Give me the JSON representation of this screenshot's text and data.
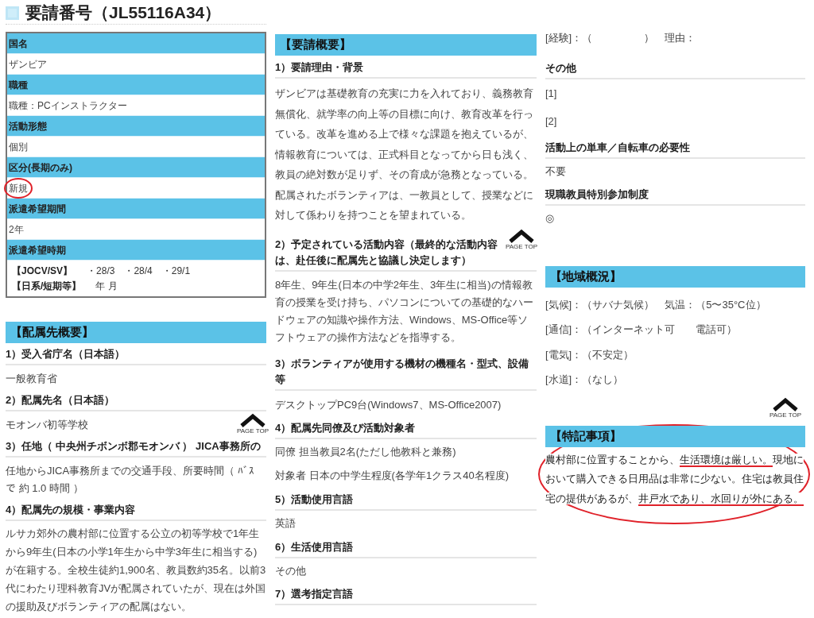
{
  "title": {
    "text": "要請番号（JL55116A34）"
  },
  "summary_table": [
    {
      "label": "国名",
      "kind": "text",
      "value": "ザンビア",
      "circled": false
    },
    {
      "label": "職種",
      "kind": "text",
      "value": "職種：PCインストラクター",
      "circled": false
    },
    {
      "label": "活動形態",
      "kind": "text",
      "value": "個別",
      "circled": false
    },
    {
      "label": "区分(長期のみ)",
      "kind": "text",
      "value": "新規",
      "circled": true
    },
    {
      "label": "派遣希望期間",
      "kind": "text",
      "value": "2年",
      "circled": false
    },
    {
      "label": "派遣希望時期",
      "kind": "periods",
      "lines": [
        {
          "label": "【JOCV/SV】",
          "value": "・28/3　・28/4　・29/1"
        },
        {
          "label": "【日系/短期等】",
          "value": "年 月"
        }
      ],
      "circled": false
    }
  ],
  "host_overview": {
    "title": "【配属先概要】",
    "items": [
      {
        "heading": "1）受入省庁名（日本語）",
        "body": [
          "一般教育省"
        ]
      },
      {
        "heading": "2）配属先名（日本語）",
        "body": [
          "モオンバ初等学校"
        ]
      },
      {
        "heading": "3）任地（ 中央州チボンボ郡モオンバ ） JICA事務所の",
        "body": [
          "任地からJICA事務所までの交通手段、所要時間（ ﾊﾞｽで 約 1.0 時間 ）"
        ]
      },
      {
        "heading": "4）配属先の規模・事業内容",
        "body": [
          "ルサカ郊外の農村部に位置する公立の初等学校で1年生から9年生(日本の小学1年生から中学3年生に相当する)が在籍する。全校生徒約1,900名、教員数約35名。以前3代にわたり理科教育JVが配属されていたが、現在は外国の援助及びボランティアの配属はない。"
        ]
      }
    ]
  },
  "request_overview": {
    "title": "【要請概要】",
    "items": [
      {
        "heading": "1）要請理由・背景",
        "body": [
          "ザンビアは基礎教育の充実に力を入れており、義務教育無償化、就学率の向上等の目標に向け、教育改革を行っている。改革を進める上で様々な課題を抱えているが、情報教育については、正式科目となってから日も浅く、教員の絶対数が足りず、その育成が急務となっている。配属されたボランティアは、一教員として、授業などに対して係わりを持つことを望まれている。"
        ]
      },
      {
        "heading": "2）予定されている活動内容（最終的な活動内容は、赴任後に配属先と協議し決定します）",
        "body": [
          "8年生、9年生(日本の中学2年生、3年生に相当)の情報教育の授業を受け持ち、パソコンについての基礎的なハードウェアの知識や操作方法、Windows、MS-Office等ソフトウェアの操作方法などを指導する。"
        ]
      },
      {
        "heading": "3）ボランティアが使用する機材の機種名・型式、設備等",
        "body": [
          "デスクトップPC9台(Windows7、MS-Office2007)"
        ]
      },
      {
        "heading": "4）配属先同僚及び活動対象者",
        "body": [
          "同僚 担当教員2名(ただし他教科と兼務)",
          "対象者 日本の中学生程度(各学年1クラス40名程度)"
        ]
      },
      {
        "heading": "5）活動使用言語",
        "body": [
          "英語"
        ]
      },
      {
        "heading": "6）生活使用言語",
        "body": [
          "その他"
        ]
      },
      {
        "heading": "7）選考指定言語"
      }
    ]
  },
  "requirements": {
    "experience": "[経験]：（　　　　　）　理由：",
    "items": [
      {
        "heading": "その他",
        "body": [
          "[1]",
          "[2]"
        ]
      },
      {
        "heading": "活動上の単車／自転車の必要性",
        "body": [
          "不要"
        ]
      },
      {
        "heading": "現職教員特別参加制度",
        "body": [
          "◎"
        ]
      }
    ]
  },
  "region": {
    "title": "【地域概況】",
    "lines": [
      "[気候]：（サバナ気候）　気温：（5〜35°C位）",
      "[通信]：（インターネット可　　電話可）",
      "[電気]：（不安定）",
      "[水道]：（なし）"
    ]
  },
  "notes": {
    "title": "【特記事項】",
    "circled": true,
    "segments": [
      {
        "text": "農村部に位置することから、",
        "underlined": false
      },
      {
        "text": "生活環境は厳しい。",
        "underlined": true
      },
      {
        "text": "現地において購入できる日用品は非常に少ない。住宅は教員住宅の提供があるが、",
        "underlined": false
      },
      {
        "text": "井戸水であり、水回りが外にある。",
        "underlined": true
      }
    ]
  },
  "page_top_buttons": [
    {
      "label": "PAGE TOP"
    },
    {
      "label": "PAGE TOP"
    },
    {
      "label": "PAGE TOP"
    }
  ]
}
